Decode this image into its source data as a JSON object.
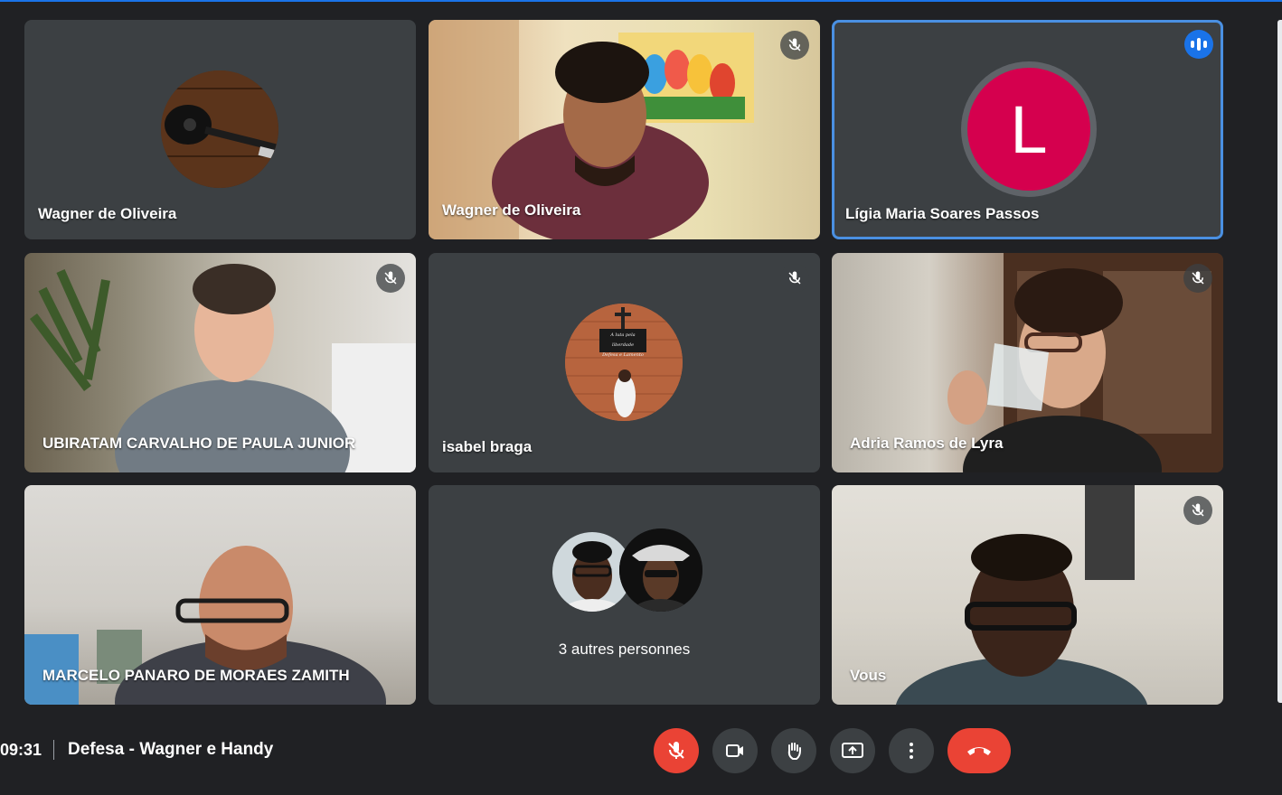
{
  "tiles": [
    {
      "name": "Wagner de Oliveira",
      "kind": "avatar-photo",
      "muted": false
    },
    {
      "name": "Wagner de Oliveira",
      "kind": "video",
      "muted": true
    },
    {
      "name": "Lígia Maria Soares Passos",
      "kind": "initial",
      "initial": "L",
      "avatar_color": "#d5004e",
      "speaking": true
    },
    {
      "name": "UBIRATAM CARVALHO DE PAULA JUNIOR",
      "kind": "video",
      "muted": true
    },
    {
      "name": "isabel braga",
      "kind": "avatar-photo",
      "muted": true
    },
    {
      "name": "Adria Ramos de Lyra",
      "kind": "video",
      "muted": true
    },
    {
      "name": "MARCELO PANARO DE MORAES ZAMITH",
      "kind": "video",
      "muted": false
    },
    {
      "name": "3 autres personnes",
      "kind": "group",
      "muted": false
    },
    {
      "name": "Vous",
      "kind": "video",
      "muted": true
    }
  ],
  "isabel_photo_text": {
    "line1": "A luta pela liberdade",
    "line2": "Defesa e Lamento"
  },
  "footer": {
    "time": "09:31",
    "meeting_title": "Defesa - Wagner e Handy"
  },
  "controls": [
    "mic-off-icon",
    "camera-icon",
    "raise-hand-icon",
    "present-screen-icon",
    "more-options-icon",
    "hang-up-icon"
  ],
  "colors": {
    "background": "#202124",
    "tile": "#3c4043",
    "danger": "#ea4335",
    "accent": "#1a73e8"
  }
}
